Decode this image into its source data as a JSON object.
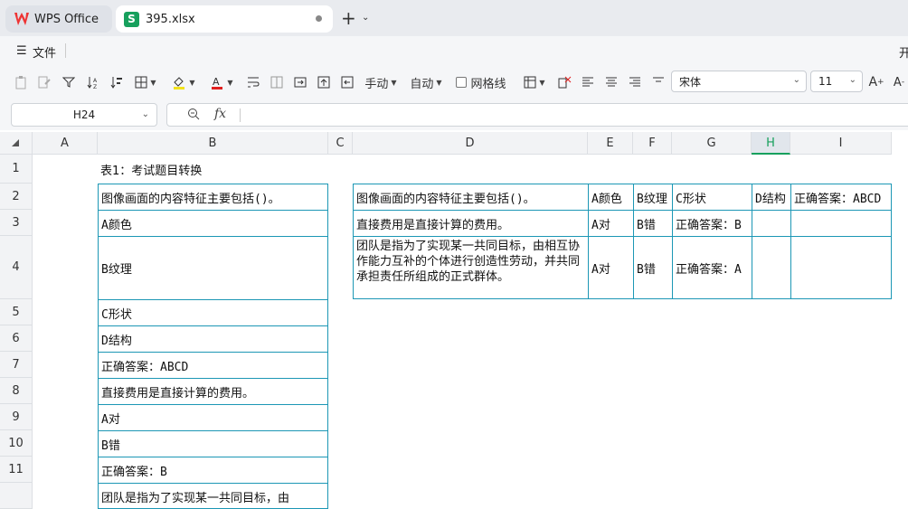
{
  "tabs": {
    "home": {
      "label": "WPS Office"
    },
    "file": {
      "label": "395.xlsx"
    }
  },
  "menu": {
    "file_label": "文件",
    "cut_text": "开"
  },
  "toolbar": {
    "fit_mode": "手动",
    "auto": "自动",
    "gridlines": "网格线",
    "font_name": "宋体",
    "font_size": "11"
  },
  "formula_bar": {
    "cell_ref": "H24",
    "fx": "fx",
    "content": ""
  },
  "grid": {
    "columns": [
      "A",
      "B",
      "C",
      "D",
      "E",
      "F",
      "G",
      "H",
      "I"
    ],
    "selected_column": "H",
    "rows": [
      "1",
      "2",
      "3",
      "4",
      "5",
      "6",
      "7",
      "8",
      "9",
      "10",
      "11"
    ],
    "cells": {
      "B1": "表1：考试题目转换",
      "B2": "图像画面的内容特征主要包括()。",
      "B3": "A颜色",
      "B4": "B纹理",
      "B5": "C形状",
      "B6": "D结构",
      "B7": "正确答案：ABCD",
      "B8": "直接费用是直接计算的费用。",
      "B9": "A对",
      "B10": "B错",
      "B11": "正确答案：B",
      "B12": "团队是指为了实现某一共同目标，由",
      "D2": "图像画面的内容特征主要包括()。",
      "E2": "A颜色",
      "F2": "B纹理",
      "G2": "C形状",
      "H2": "D结构",
      "I2": "正确答案：ABCD",
      "D3": "直接费用是直接计算的费用。",
      "E3": "A对",
      "F3": "B错",
      "G3": "正确答案：B",
      "D4": "团队是指为了实现某一共同目标，由相互协作能力互补的个体进行创造性劳动，并共同承担责任所组成的正式群体。",
      "E4": "A对",
      "F4": "B错",
      "G4": "正确答案：A"
    }
  },
  "colors": {
    "accent": "#17a05d",
    "border": "#1c97b5",
    "logo": "#e33333"
  }
}
